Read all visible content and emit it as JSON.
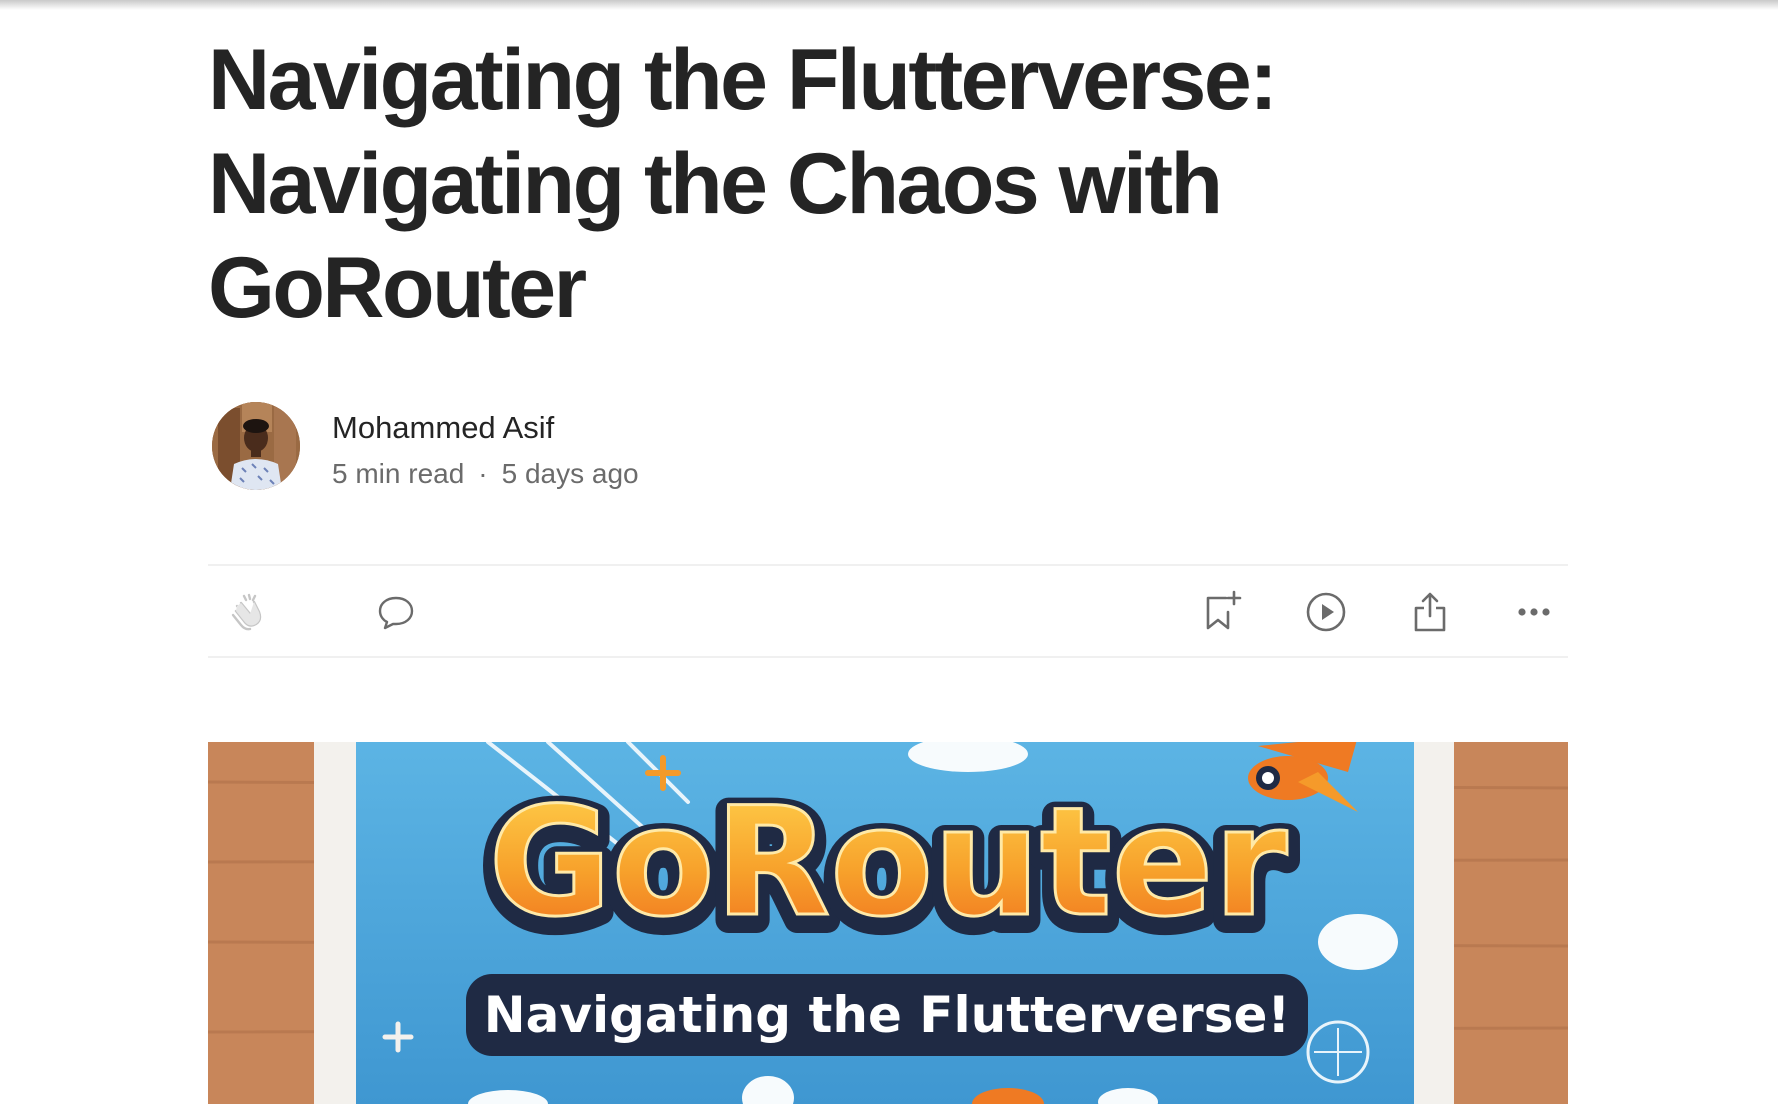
{
  "article": {
    "title_lines": [
      "Navigating the Flutterverse:",
      "Navigating the Chaos with",
      "GoRouter"
    ],
    "author": {
      "name": "Mohammed Asif",
      "read_time": "5 min read",
      "separator": "·",
      "published": "5 days ago"
    }
  },
  "actions": {
    "clap_icon": "clap-icon",
    "response_icon": "speech-bubble-icon",
    "save_icon": "bookmark-plus-icon",
    "listen_icon": "play-circle-icon",
    "share_icon": "share-icon",
    "more_icon": "more-horizontal-icon"
  },
  "hero": {
    "headline": "GoRouter",
    "subheadline": "Navigating the Flutterverse!"
  },
  "colors": {
    "text": "#242424",
    "muted": "#6b6b6b",
    "divider": "#f0f0f0",
    "hero_sky": "#4aa3d8",
    "hero_orange": "#f59a2a",
    "hero_wood": "#c8865a"
  }
}
